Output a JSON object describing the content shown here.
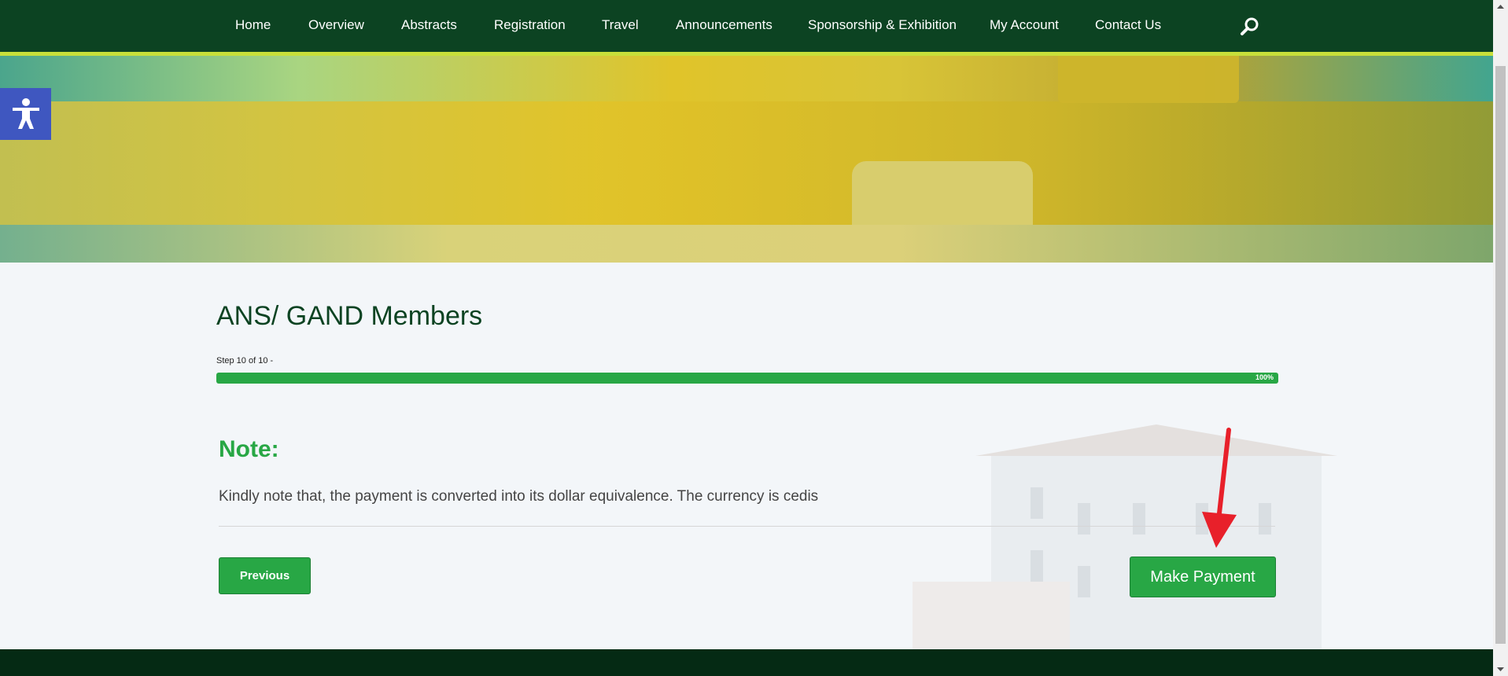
{
  "nav": {
    "items": [
      {
        "label": "Home"
      },
      {
        "label": "Overview"
      },
      {
        "label": "Abstracts"
      },
      {
        "label": "Registration"
      },
      {
        "label": "Travel"
      },
      {
        "label": "Announcements"
      },
      {
        "label": "Sponsorship & Exhibition"
      },
      {
        "label": "My Account"
      },
      {
        "label": "Contact Us"
      }
    ],
    "search_icon": "search-icon"
  },
  "accessibility": {
    "icon": "accessibility-icon"
  },
  "main": {
    "title": "ANS/ GAND Members",
    "step_label": "Step 10 of 10 -",
    "progress": {
      "percent": 100,
      "label": "100%"
    },
    "note_title": "Note:",
    "note_text": "Kindly note that, the payment is converted into its dollar equivalence. The currency is cedis",
    "previous_label": "Previous",
    "pay_label": "Make Payment"
  },
  "colors": {
    "nav_bg": "#0c4322",
    "nav_accent": "#c8df3a",
    "primary_green": "#28a745",
    "footer_bg": "#052a14",
    "a11y_bg": "#3f57c0",
    "arrow": "#e8202a"
  }
}
